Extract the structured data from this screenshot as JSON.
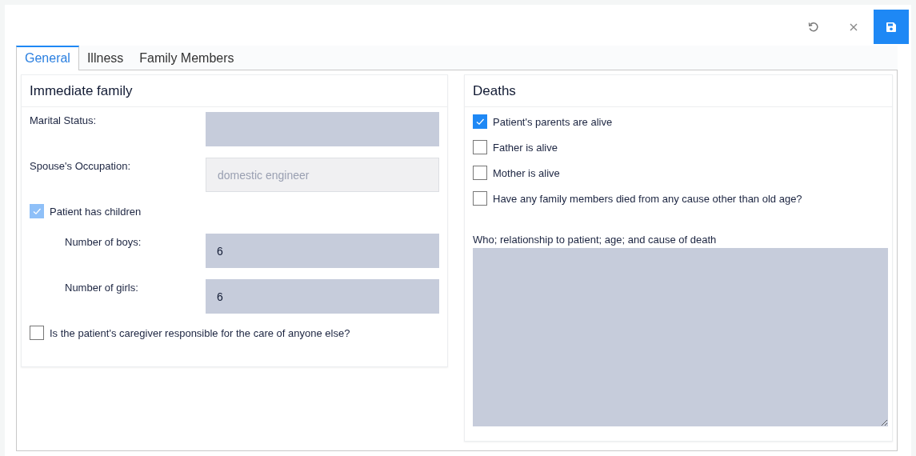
{
  "toolbar": {
    "buttons": [
      {
        "kind": "undo"
      },
      {
        "kind": "close"
      },
      {
        "kind": "save"
      }
    ]
  },
  "tabs": [
    {
      "label": "General",
      "selected": true
    },
    {
      "label": "Illness",
      "selected": false
    },
    {
      "label": "Family Members",
      "selected": false
    }
  ],
  "immediate_family": {
    "title": "Immediate family",
    "items": [
      {
        "kind": "field",
        "label": "Marital Status:",
        "disabled": false
      },
      {
        "kind": "field",
        "label": "Spouse's Occupation:",
        "value": "domestic engineer",
        "disabled": true
      },
      {
        "kind": "checkbox",
        "label": "Patient has children",
        "checked": true,
        "disabled": true,
        "children": [
          {
            "kind": "field",
            "label": "Number of boys:",
            "value": "6",
            "disabled": false
          },
          {
            "kind": "field",
            "label": "Number of girls:",
            "value": "6",
            "disabled": false
          }
        ]
      },
      {
        "kind": "checkbox",
        "label": "Is the patient's caregiver responsible for the care of anyone else?",
        "checked": false
      }
    ]
  },
  "deaths": {
    "title": "Deaths",
    "checkboxes": [
      {
        "label": "Patient's parents are alive",
        "checked": true
      },
      {
        "label": "Father is alive",
        "checked": false
      },
      {
        "label": "Mother is alive",
        "checked": false
      },
      {
        "label": "Have any family members died from any cause other than old age?",
        "checked": false
      }
    ],
    "textarea": {
      "label": "Who; relationship to patient; age; and cause of death"
    }
  }
}
